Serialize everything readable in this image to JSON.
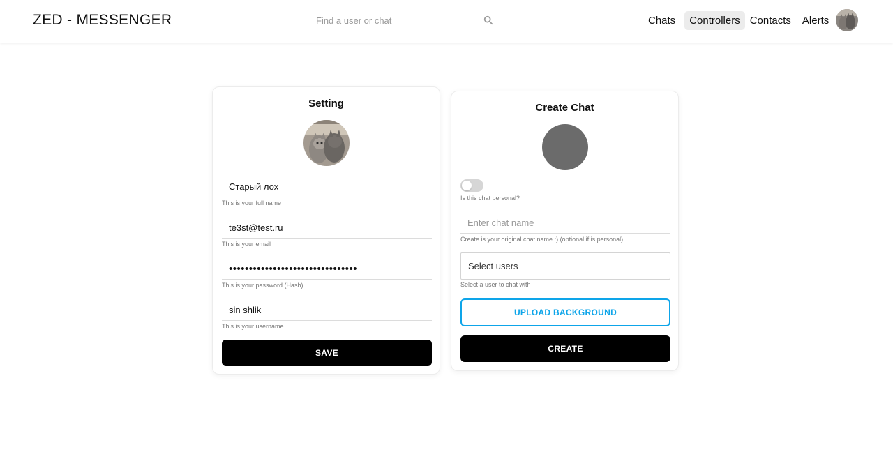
{
  "header": {
    "brand": "ZED - MESSENGER",
    "search_placeholder": "Find a user or chat",
    "nav": [
      {
        "label": "Chats",
        "active": false
      },
      {
        "label": "Controllers",
        "active": true
      },
      {
        "label": "Contacts",
        "active": false
      },
      {
        "label": "Alerts",
        "active": false
      }
    ],
    "avatar_icon": "user-avatar-cats"
  },
  "settings": {
    "title": "Setting",
    "avatar_icon": "profile-avatar-cats",
    "fields": [
      {
        "value": "Старый лох",
        "hint": "This is your full name"
      },
      {
        "value": "te3st@test.ru",
        "hint": "This is your email"
      },
      {
        "value": "••••••••••••••••••••••••••••••••",
        "hint": "This is your password (Hash)"
      },
      {
        "value": "sin shlik",
        "hint": "This is your username"
      }
    ],
    "save_label": "SAVE"
  },
  "create_chat": {
    "title": "Create Chat",
    "avatar_color": "#6b6b6b",
    "personal_toggle_on": false,
    "personal_hint": "Is this chat personal?",
    "name_placeholder": "Enter chat name",
    "name_hint": "Create is your original chat name :) (optional if is personal)",
    "select_users_label": "Select users",
    "select_users_hint": "Select a user to chat with",
    "upload_label": "UPLOAD BACKGROUND",
    "create_label": "CREATE"
  },
  "colors": {
    "accent": "#0ea5e9",
    "primary_button": "#000000",
    "nav_active_bg": "#ececec"
  }
}
